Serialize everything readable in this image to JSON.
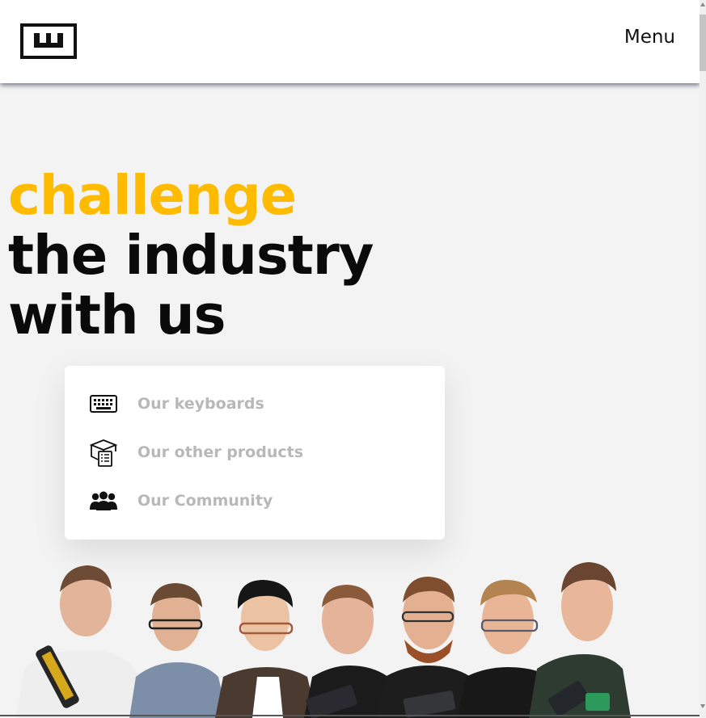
{
  "header": {
    "logo_icon": "brand-logo-icon",
    "menu_label": "Menu"
  },
  "hero": {
    "line1": "challenge",
    "line2": "the industry",
    "line3": "with us",
    "accent_color": "#ffbb00"
  },
  "nav_card": {
    "items": [
      {
        "label": "Our keyboards",
        "icon": "keyboard-icon"
      },
      {
        "label": "Our other products",
        "icon": "box-checklist-icon"
      },
      {
        "label": "Our Community",
        "icon": "people-group-icon"
      }
    ]
  },
  "team_photo": {
    "people_count": 7
  }
}
